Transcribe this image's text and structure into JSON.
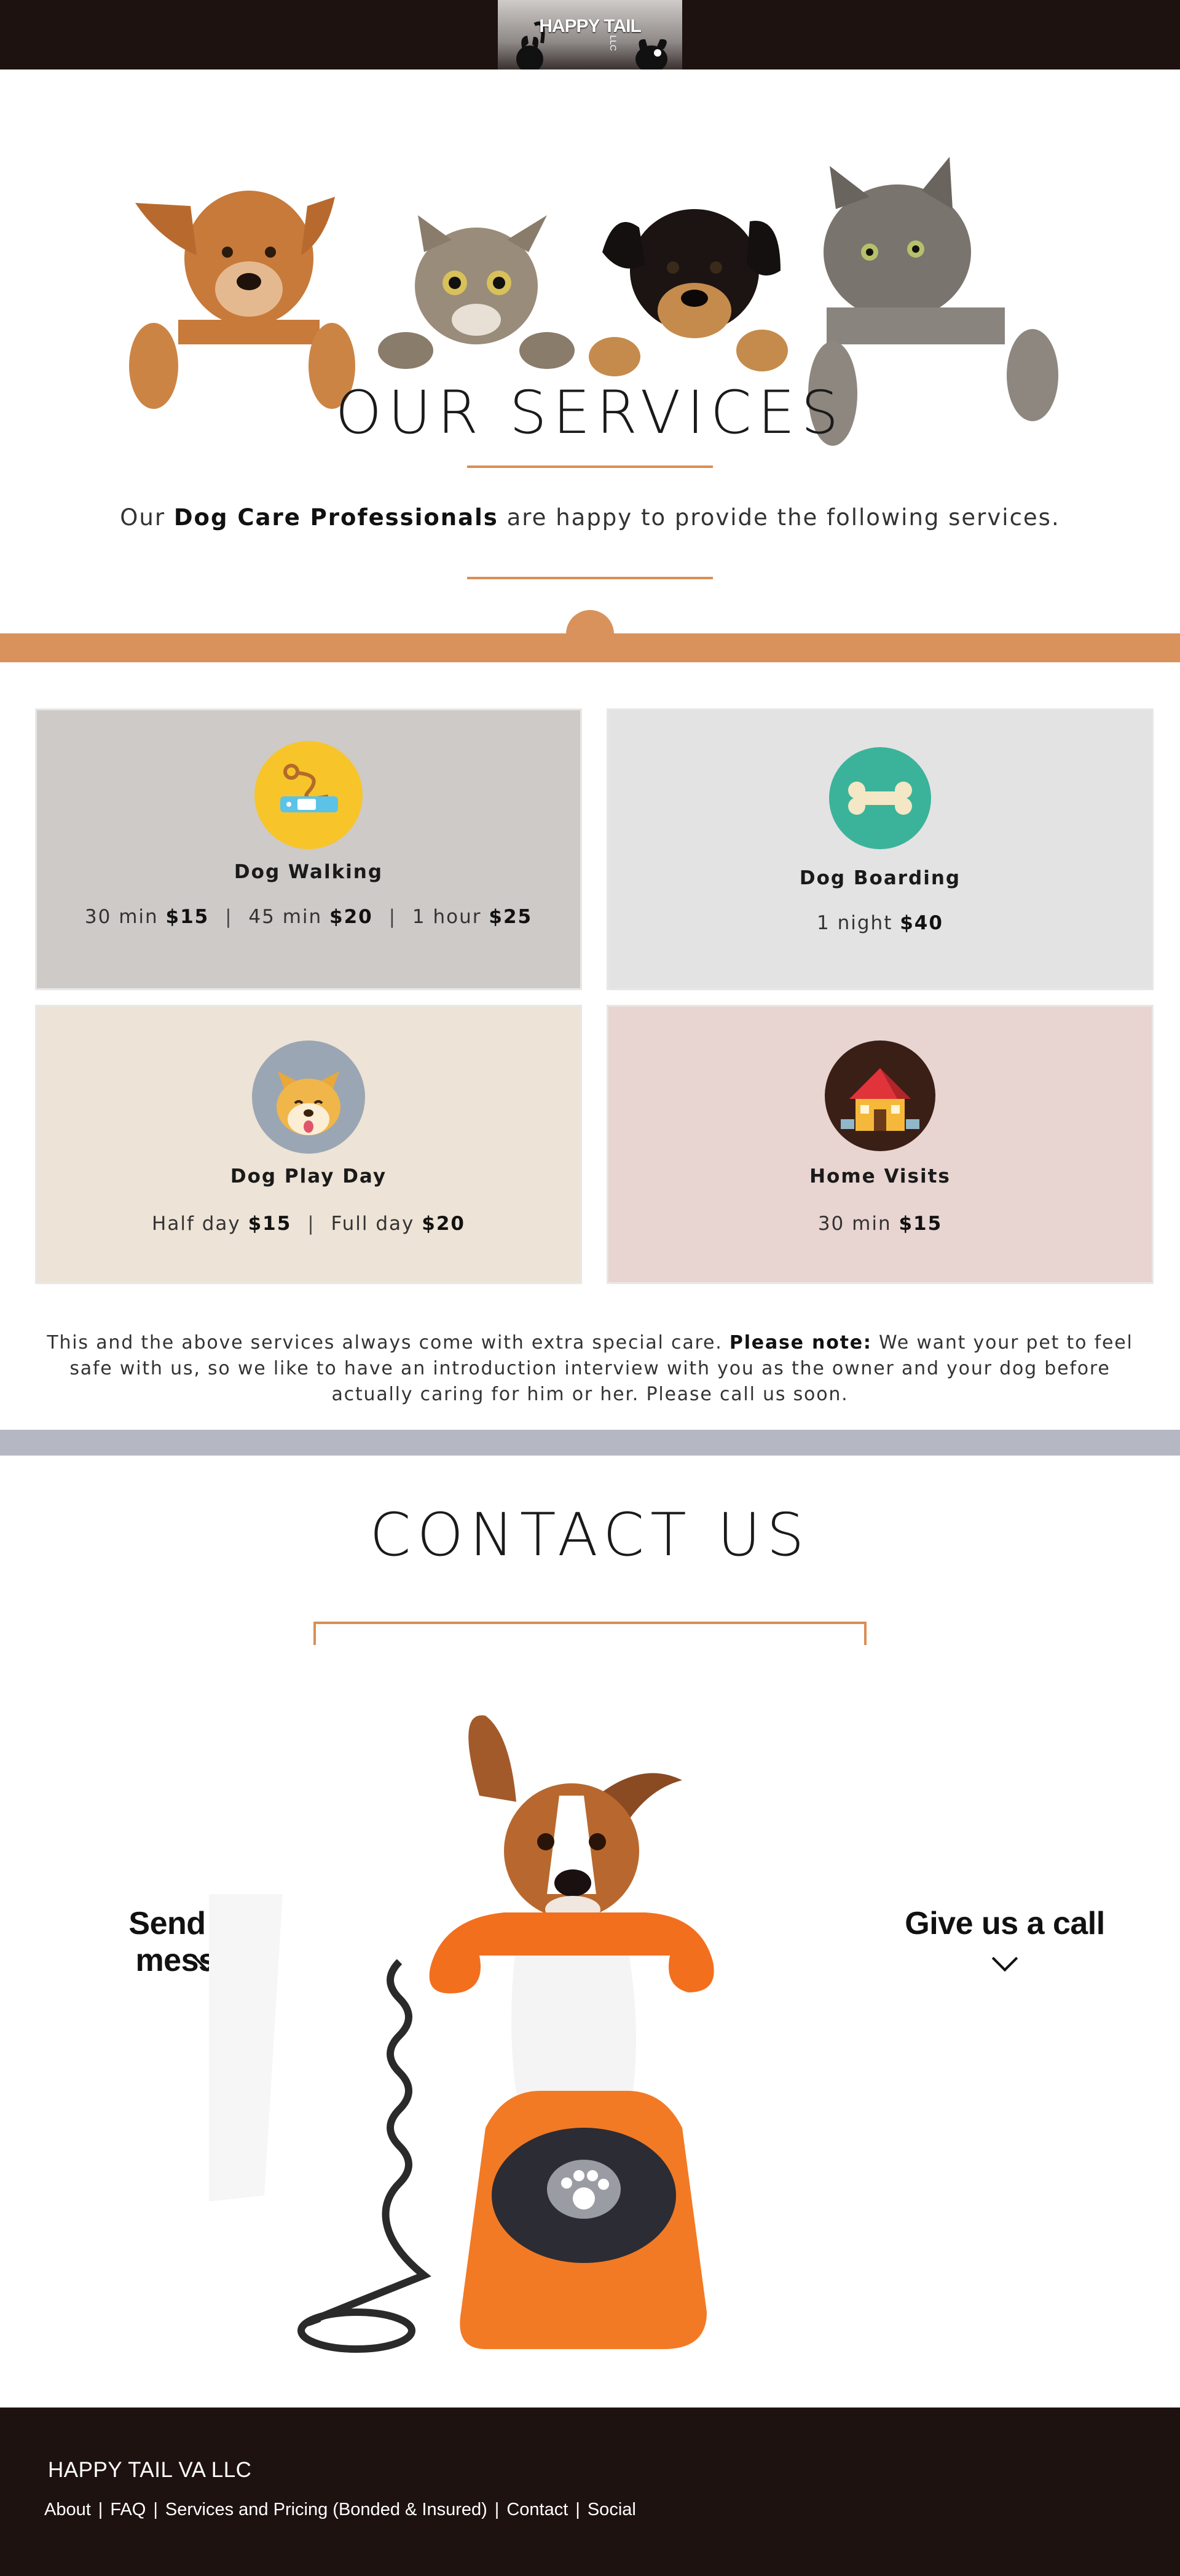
{
  "header": {
    "logo_text": "HAPPY TAIL",
    "logo_suffix": "LLC"
  },
  "services": {
    "title": "OUR SERVICES",
    "intro_prefix": "Our",
    "intro_bold": "Dog Care Professionals",
    "intro_suffix": "are happy to provide the following services."
  },
  "cards": [
    {
      "title": "Dog Walking",
      "icon": "leash-icon",
      "bg": "#cdcac8",
      "prices": [
        {
          "label": "30 min",
          "price": "$15"
        },
        {
          "label": "45 min",
          "price": "$20"
        },
        {
          "label": "1 hour",
          "price": "$25"
        }
      ]
    },
    {
      "title": "Dog Boarding",
      "icon": "bone-icon",
      "bg": "#e3e3e3",
      "prices": [
        {
          "label": "1 night",
          "price": "$40"
        }
      ]
    },
    {
      "title": "Dog Play Day",
      "icon": "dog-face-icon",
      "bg": "#ede3d6",
      "prices": [
        {
          "label": "Half day",
          "price": "$15"
        },
        {
          "label": "Full day",
          "price": "$20"
        }
      ]
    },
    {
      "title": "Home Visits",
      "icon": "house-icon",
      "bg": "#e8d4d0",
      "prices": [
        {
          "label": "30 min",
          "price": "$15"
        }
      ]
    }
  ],
  "note": {
    "text_before": "This and the above services always come with extra special care.",
    "bold": "Please note:",
    "text_after": "We want your pet to feel safe with us, so we like to have an introduction interview with you as the owner and your dog before actually caring for him or her. Please call us soon."
  },
  "contact": {
    "title": "CONTACT US",
    "message_label": "Send us a message",
    "call_label": "Give us a call"
  },
  "footer": {
    "brand": "HAPPY TAIL VA LLC",
    "nav": [
      "About",
      "FAQ",
      "Services and Pricing (Bonded & Insured)",
      "Contact",
      "Social"
    ]
  },
  "colors": {
    "header_bg": "#1e1210",
    "accent_orange": "#d9925b",
    "band_gray": "#b5b8c2"
  }
}
